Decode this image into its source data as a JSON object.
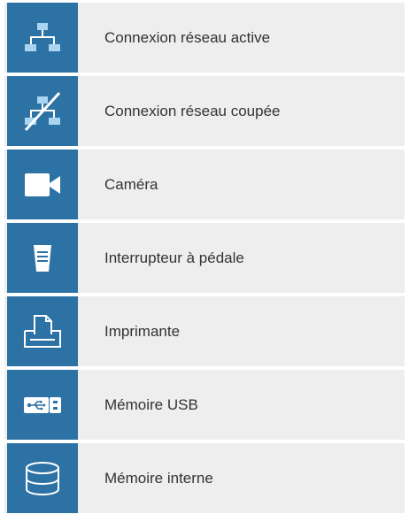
{
  "accent_color": "#2d72a5",
  "row_background": "#eeeeee",
  "items": [
    {
      "icon": "network-active-icon",
      "label": "Connexion réseau active"
    },
    {
      "icon": "network-disconnected-icon",
      "label": "Connexion réseau coupée"
    },
    {
      "icon": "camera-icon",
      "label": "Caméra"
    },
    {
      "icon": "foot-switch-icon",
      "label": "Interrupteur à pédale"
    },
    {
      "icon": "printer-icon",
      "label": "Imprimante"
    },
    {
      "icon": "usb-memory-icon",
      "label": "Mémoire USB"
    },
    {
      "icon": "internal-memory-icon",
      "label": "Mémoire interne"
    }
  ]
}
